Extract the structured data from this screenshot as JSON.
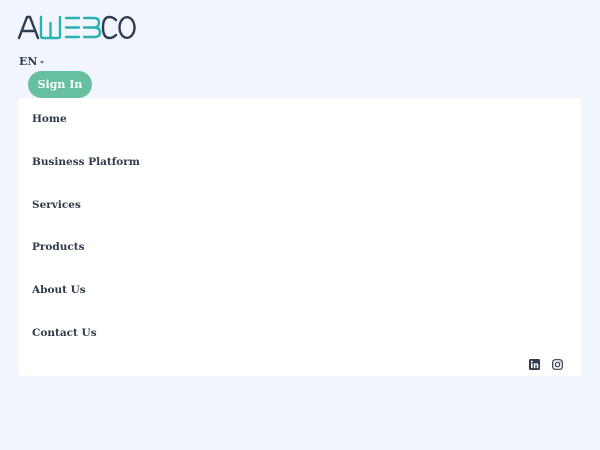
{
  "brand": {
    "logo_icon": "awebco-logo",
    "logo_text": "AWEBCO",
    "colors": {
      "dark": "#303c4c",
      "teal": "#2ab1b1",
      "accent": "#66bf9f"
    }
  },
  "header": {
    "language": "EN",
    "sign_in_label": "Sign In"
  },
  "nav": {
    "items": [
      {
        "label": "Home"
      },
      {
        "label": "Business Platform"
      },
      {
        "label": "Services"
      },
      {
        "label": "Products"
      },
      {
        "label": "About Us"
      },
      {
        "label": "Contact Us"
      }
    ]
  },
  "social": [
    {
      "icon": "linkedin-icon"
    },
    {
      "icon": "instagram-icon"
    }
  ]
}
